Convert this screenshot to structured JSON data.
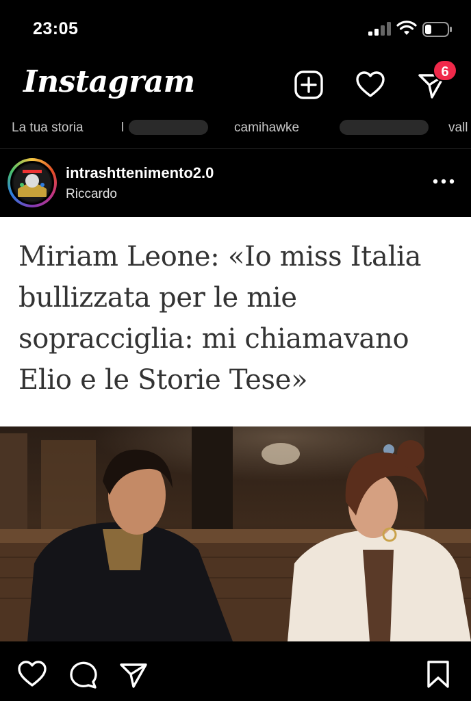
{
  "status_bar": {
    "time": "23:05"
  },
  "header": {
    "app_name": "Instagram",
    "notification_count": "6"
  },
  "stories": [
    {
      "label": "La tua storia"
    },
    {
      "label": "l"
    },
    {
      "label": "camihawke"
    },
    {
      "label": "vall"
    }
  ],
  "post": {
    "username": "intrashttenimento2.0",
    "subtitle": "Riccardo",
    "headline": "Miriam Leone: «Io miss Italia bullizzata per le mie sopracciglia: mi chiamavano Elio e le Storie Tese»"
  },
  "icons": {
    "new_post": "plus-square-icon",
    "activity": "heart-icon",
    "direct": "paper-plane-icon",
    "like": "heart-icon",
    "comment": "comment-icon",
    "share": "paper-plane-icon",
    "save": "bookmark-icon"
  },
  "colors": {
    "background": "#000000",
    "badge": "#f0294a"
  }
}
